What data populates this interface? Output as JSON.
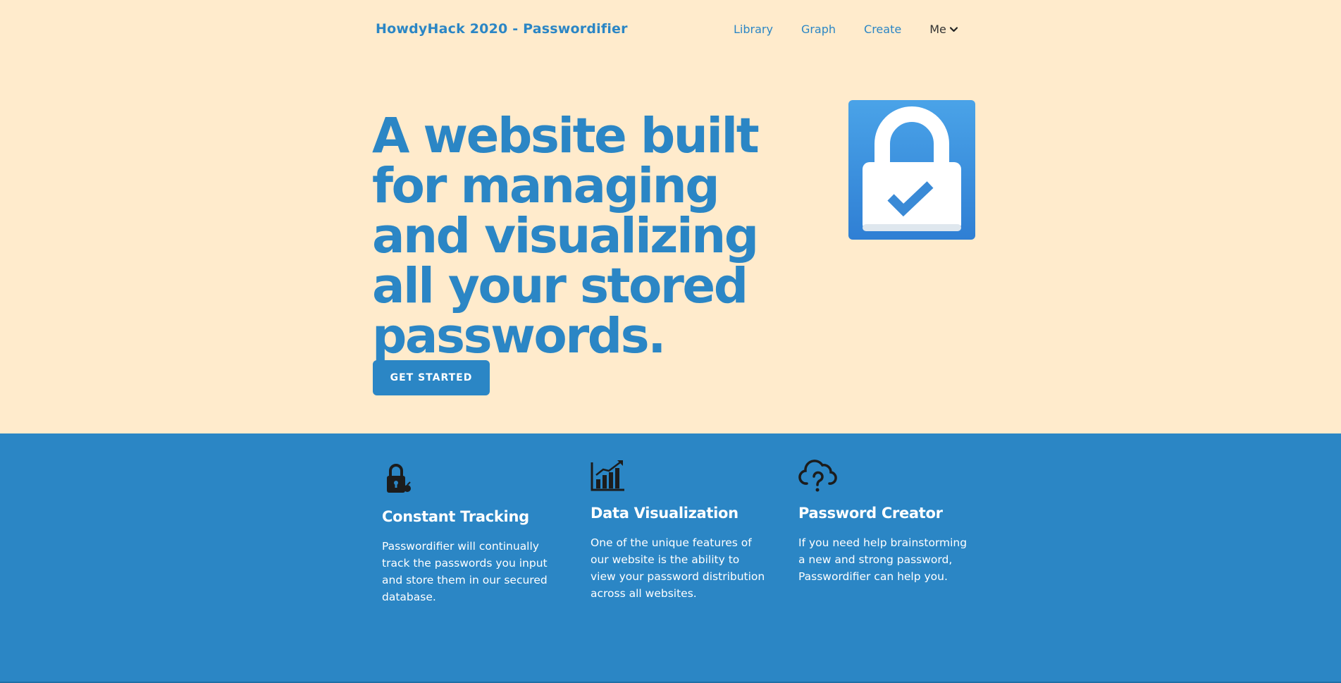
{
  "nav": {
    "brand": "HowdyHack 2020 - Passwordifier",
    "links": [
      {
        "label": "Library"
      },
      {
        "label": "Graph"
      },
      {
        "label": "Create"
      }
    ],
    "account_label": "Me"
  },
  "hero": {
    "title": "A website built for managing and visualizing all your stored passwords.",
    "cta_label": "GET STARTED",
    "logo_icon": "padlock-check-icon"
  },
  "features": [
    {
      "icon": "lock-icon",
      "title": "Constant Tracking",
      "text": "Passwordifier will continually track the passwords you input and store them in our secured database."
    },
    {
      "icon": "chart-growth-icon",
      "title": "Data Visualization",
      "text": "One of the unique features of our website is the ability to view your password distribution across all websites."
    },
    {
      "icon": "cloud-question-icon",
      "title": "Password Creator",
      "text": "If you need help brainstorming a new and strong password, Passwordifier can help you."
    }
  ],
  "colors": {
    "background": "#ffebcc",
    "primary": "#2b86c5",
    "text_dark": "#333333"
  }
}
